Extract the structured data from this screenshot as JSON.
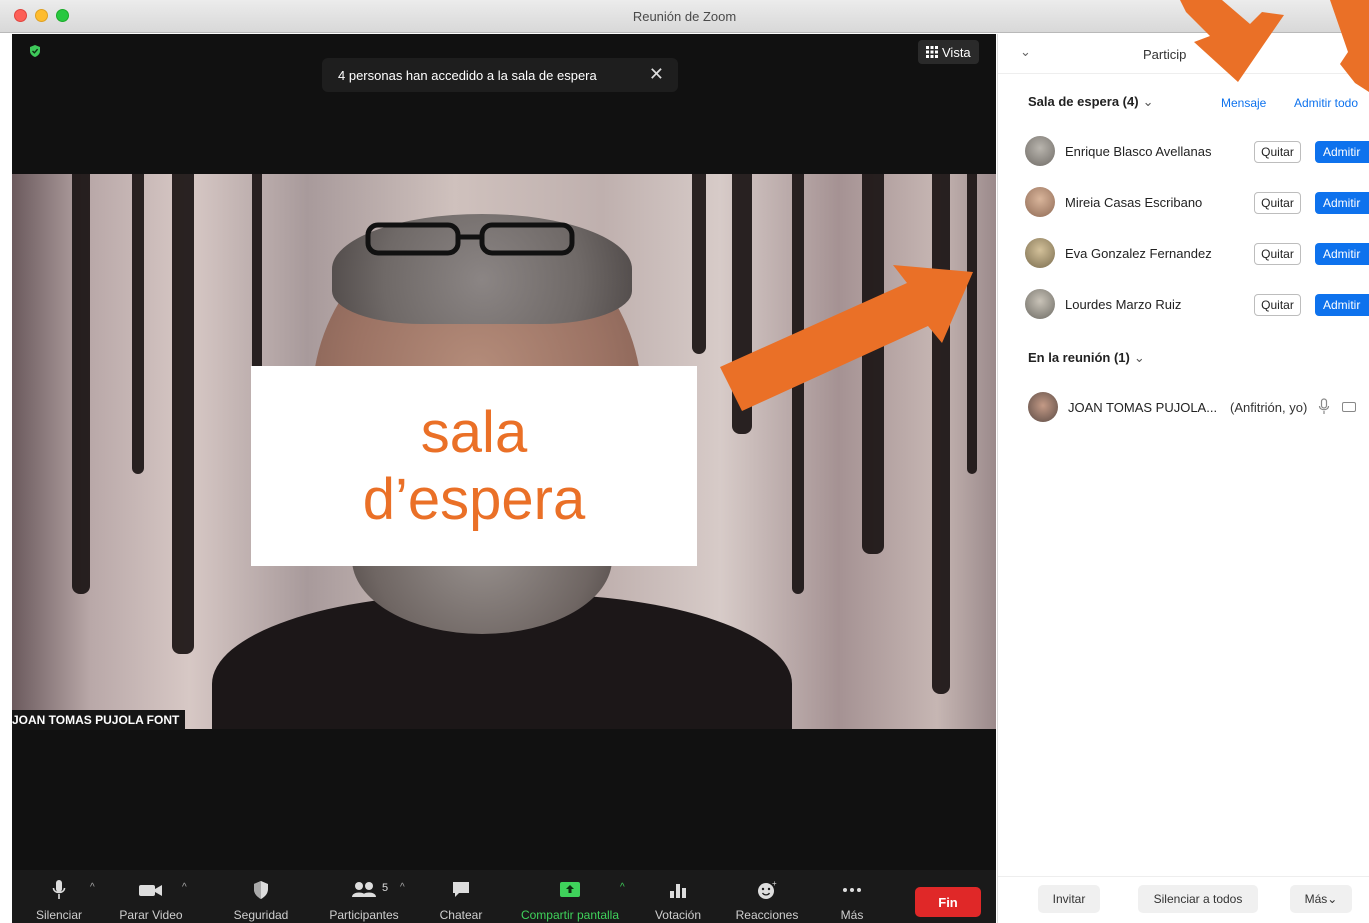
{
  "window": {
    "title": "Reunión de Zoom"
  },
  "video": {
    "notice_text": "4 personas han accedido a la sala de espera",
    "notice_close": "✕",
    "view_button": "Vista",
    "speaker_name": "JOAN TOMAS PUJOLA FONT"
  },
  "overlay": {
    "line1": "sala",
    "line2": "d’espera",
    "color": "#ea7027"
  },
  "toolbar": {
    "items": [
      {
        "label": "Silenciar",
        "icon": "microphone-icon"
      },
      {
        "label": "Parar Video",
        "icon": "video-camera-icon"
      },
      {
        "label": "Seguridad",
        "icon": "shield-icon"
      },
      {
        "label": "Participantes",
        "icon": "participants-icon",
        "count": "5"
      },
      {
        "label": "Chatear",
        "icon": "chat-icon"
      },
      {
        "label": "Compartir pantalla",
        "icon": "share-screen-icon"
      },
      {
        "label": "Votación",
        "icon": "poll-icon"
      },
      {
        "label": "Reacciones",
        "icon": "reactions-icon"
      },
      {
        "label": "Más",
        "icon": "more-icon"
      }
    ],
    "end_button": "Fin"
  },
  "panel": {
    "title": "Particip",
    "waiting_room": {
      "heading": "Sala de espera (4)",
      "message_link": "Mensaje",
      "admit_all_link": "Admitir todo",
      "remove_label": "Quitar",
      "admit_label": "Admitir",
      "people": [
        {
          "name": "Enrique Blasco Avellanas"
        },
        {
          "name": "Mireia Casas Escribano"
        },
        {
          "name": "Eva Gonzalez Fernandez"
        },
        {
          "name": "Lourdes Marzo Ruiz"
        }
      ]
    },
    "in_meeting": {
      "heading": "En la reunión (1)",
      "host_name": "JOAN TOMAS PUJOLA...",
      "host_role": "(Anfitrión, yo)"
    },
    "footer": {
      "invite": "Invitar",
      "mute_all": "Silenciar a todos",
      "more": "Más"
    }
  },
  "colors": {
    "accent_blue": "#0e72ed",
    "end_red": "#e02828",
    "share_green": "#3fd25b",
    "annotation_orange": "#ea7027"
  }
}
